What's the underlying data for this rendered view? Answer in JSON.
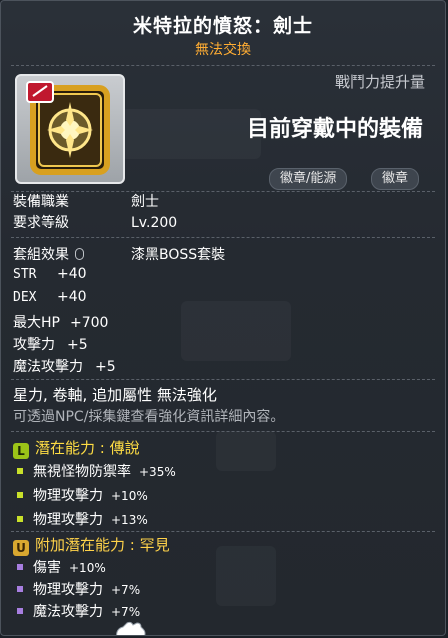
{
  "item": {
    "title": "米特拉的憤怒：劍士",
    "trade_status": "無法交換",
    "power_label": "戰鬥力提升量",
    "equipped_text": "目前穿戴中的裝備",
    "tags": [
      "徽章/能源",
      "徽章"
    ]
  },
  "requirements": [
    {
      "label": "裝備職業",
      "value": "劍士"
    },
    {
      "label": "要求等級",
      "value": "Lv.200"
    }
  ],
  "set_effect": {
    "label": "套組效果",
    "value": "漆黑BOSS套裝"
  },
  "stats": [
    {
      "name": "STR",
      "value": "+40"
    },
    {
      "name": "DEX",
      "value": "+40"
    },
    {
      "name": "最大HP",
      "value": "+700"
    },
    {
      "name": "攻擊力",
      "value": "+5"
    },
    {
      "name": "魔法攻擊力",
      "value": "+5"
    }
  ],
  "notes": {
    "restriction": "星力, 卷軸, 追加屬性 無法強化",
    "hint": "可透過NPC/採集鍵查看強化資訊詳細內容。"
  },
  "potential": {
    "grade_letter": "L",
    "title": "潛在能力 : 傳說",
    "color": "#c8e02a",
    "lines": [
      {
        "name": "無視怪物防禦率",
        "value": "+35%"
      },
      {
        "name": "物理攻擊力",
        "value": "+10%"
      },
      {
        "name": "物理攻擊力",
        "value": "+13%"
      }
    ]
  },
  "bonus_potential": {
    "grade_letter": "U",
    "title": "附加潛在能力 : 罕見",
    "color": "#d9a830",
    "lines": [
      {
        "name": "傷害",
        "value": "+10%"
      },
      {
        "name": "物理攻擊力",
        "value": "+7%"
      },
      {
        "name": "魔法攻擊力",
        "value": "+7%"
      }
    ],
    "bullet_colors": [
      "#a77ee0",
      "#a77ee0",
      "#a77ee0"
    ]
  }
}
